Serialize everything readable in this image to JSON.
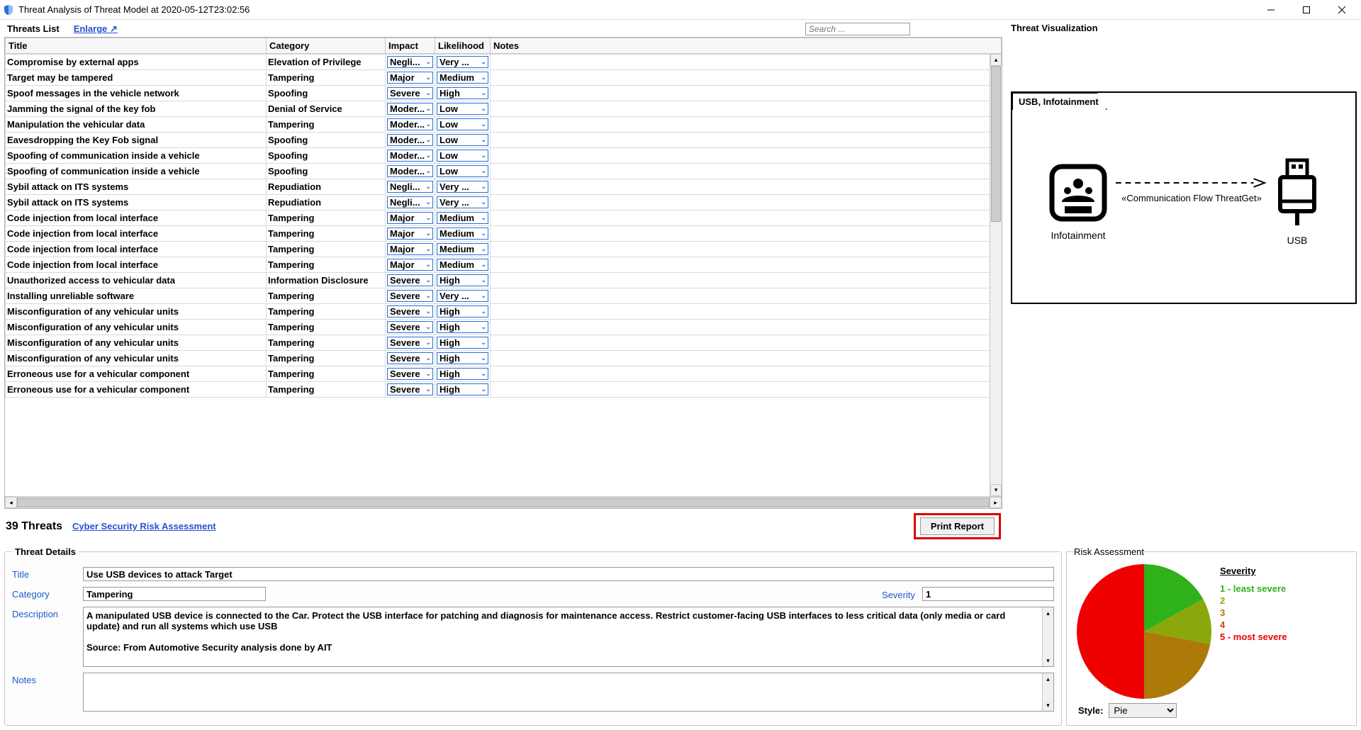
{
  "window": {
    "title": "Threat Analysis of Threat Model at 2020-05-12T23:02:56"
  },
  "threats_list": {
    "heading": "Threats List",
    "enlarge": "Enlarge ↗",
    "search_placeholder": "Search ...",
    "columns": {
      "title": "Title",
      "category": "Category",
      "impact": "Impact",
      "likelihood": "Likelihood",
      "notes": "Notes"
    },
    "rows": [
      {
        "title": "Compromise by external apps",
        "category": "Elevation of Privilege",
        "impact": "Negli...",
        "likelihood": "Very ..."
      },
      {
        "title": "Target may be tampered",
        "category": "Tampering",
        "impact": "Major",
        "likelihood": "Medium"
      },
      {
        "title": "Spoof messages in the vehicle network",
        "category": "Spoofing",
        "impact": "Severe",
        "likelihood": "High"
      },
      {
        "title": "Jamming the signal of the key fob",
        "category": "Denial of Service",
        "impact": "Moder...",
        "likelihood": "Low"
      },
      {
        "title": "Manipulation the vehicular data",
        "category": "Tampering",
        "impact": "Moder...",
        "likelihood": "Low"
      },
      {
        "title": "Eavesdropping the Key Fob signal",
        "category": "Spoofing",
        "impact": "Moder...",
        "likelihood": "Low"
      },
      {
        "title": "Spoofing of communication inside a vehicle",
        "category": "Spoofing",
        "impact": "Moder...",
        "likelihood": "Low"
      },
      {
        "title": "Spoofing of communication inside a vehicle",
        "category": "Spoofing",
        "impact": "Moder...",
        "likelihood": "Low"
      },
      {
        "title": "Sybil attack on ITS systems",
        "category": "Repudiation",
        "impact": "Negli...",
        "likelihood": "Very ..."
      },
      {
        "title": "Sybil attack on ITS systems",
        "category": "Repudiation",
        "impact": "Negli...",
        "likelihood": "Very ..."
      },
      {
        "title": "Code injection from local interface",
        "category": "Tampering",
        "impact": "Major",
        "likelihood": "Medium"
      },
      {
        "title": "Code injection from local interface",
        "category": "Tampering",
        "impact": "Major",
        "likelihood": "Medium"
      },
      {
        "title": "Code injection from local interface",
        "category": "Tampering",
        "impact": "Major",
        "likelihood": "Medium"
      },
      {
        "title": "Code injection from local interface",
        "category": "Tampering",
        "impact": "Major",
        "likelihood": "Medium"
      },
      {
        "title": "Unauthorized access to vehicular data",
        "category": "Information Disclosure",
        "impact": "Severe",
        "likelihood": "High"
      },
      {
        "title": "Installing unreliable software",
        "category": "Tampering",
        "impact": "Severe",
        "likelihood": "Very ..."
      },
      {
        "title": "Misconfiguration of any vehicular units",
        "category": "Tampering",
        "impact": "Severe",
        "likelihood": "High"
      },
      {
        "title": "Misconfiguration of any vehicular units",
        "category": "Tampering",
        "impact": "Severe",
        "likelihood": "High"
      },
      {
        "title": "Misconfiguration of any vehicular units",
        "category": "Tampering",
        "impact": "Severe",
        "likelihood": "High"
      },
      {
        "title": "Misconfiguration of any vehicular units",
        "category": "Tampering",
        "impact": "Severe",
        "likelihood": "High"
      },
      {
        "title": "Erroneous use for a vehicular component",
        "category": "Tampering",
        "impact": "Severe",
        "likelihood": "High"
      },
      {
        "title": "Erroneous use for a vehicular component",
        "category": "Tampering",
        "impact": "Severe",
        "likelihood": "High"
      }
    ]
  },
  "summary": {
    "count_label": "39 Threats",
    "link": "Cyber Security Risk Assessment",
    "print": "Print Report"
  },
  "visualization": {
    "heading": "Threat Visualization",
    "boundary_label": "USB, Infotainment",
    "left_node": "Infotainment",
    "right_node": "USB",
    "flow_label": "«Communication Flow ThreatGet»"
  },
  "details": {
    "heading": "Threat Details",
    "labels": {
      "title": "Title",
      "category": "Category",
      "severity": "Severity",
      "description": "Description",
      "notes": "Notes"
    },
    "title": "Use USB devices to attack Target",
    "category": "Tampering",
    "severity": "1",
    "description": "A manipulated USB device is connected to the Car. Protect the USB interface for patching and diagnosis for maintenance access. Restrict customer-facing USB interfaces to less critical data (only media or card update) and run all systems which use USB\n\nSource: From Automotive Security analysis done by AIT",
    "notes": ""
  },
  "risk": {
    "heading": "Risk Assessment",
    "legend_title": "Severity",
    "legend": [
      {
        "text": "1 - least severe",
        "color": "#2fb11a"
      },
      {
        "text": "2",
        "color": "#8aa80b"
      },
      {
        "text": "3",
        "color": "#ad7a0a"
      },
      {
        "text": "4",
        "color": "#e23a00"
      },
      {
        "text": "5 - most severe",
        "color": "#ef0000"
      }
    ],
    "style_label": "Style:",
    "style_value": "Pie"
  },
  "chart_data": {
    "type": "pie",
    "title": "Risk Assessment by Severity",
    "categories": [
      "1 - least severe",
      "2",
      "3",
      "4",
      "5 - most severe"
    ],
    "values": [
      17,
      11,
      22,
      0,
      50
    ],
    "colors": [
      "#2fb11a",
      "#8aa80b",
      "#ad7a0a",
      "#e23a00",
      "#ef0000"
    ]
  }
}
